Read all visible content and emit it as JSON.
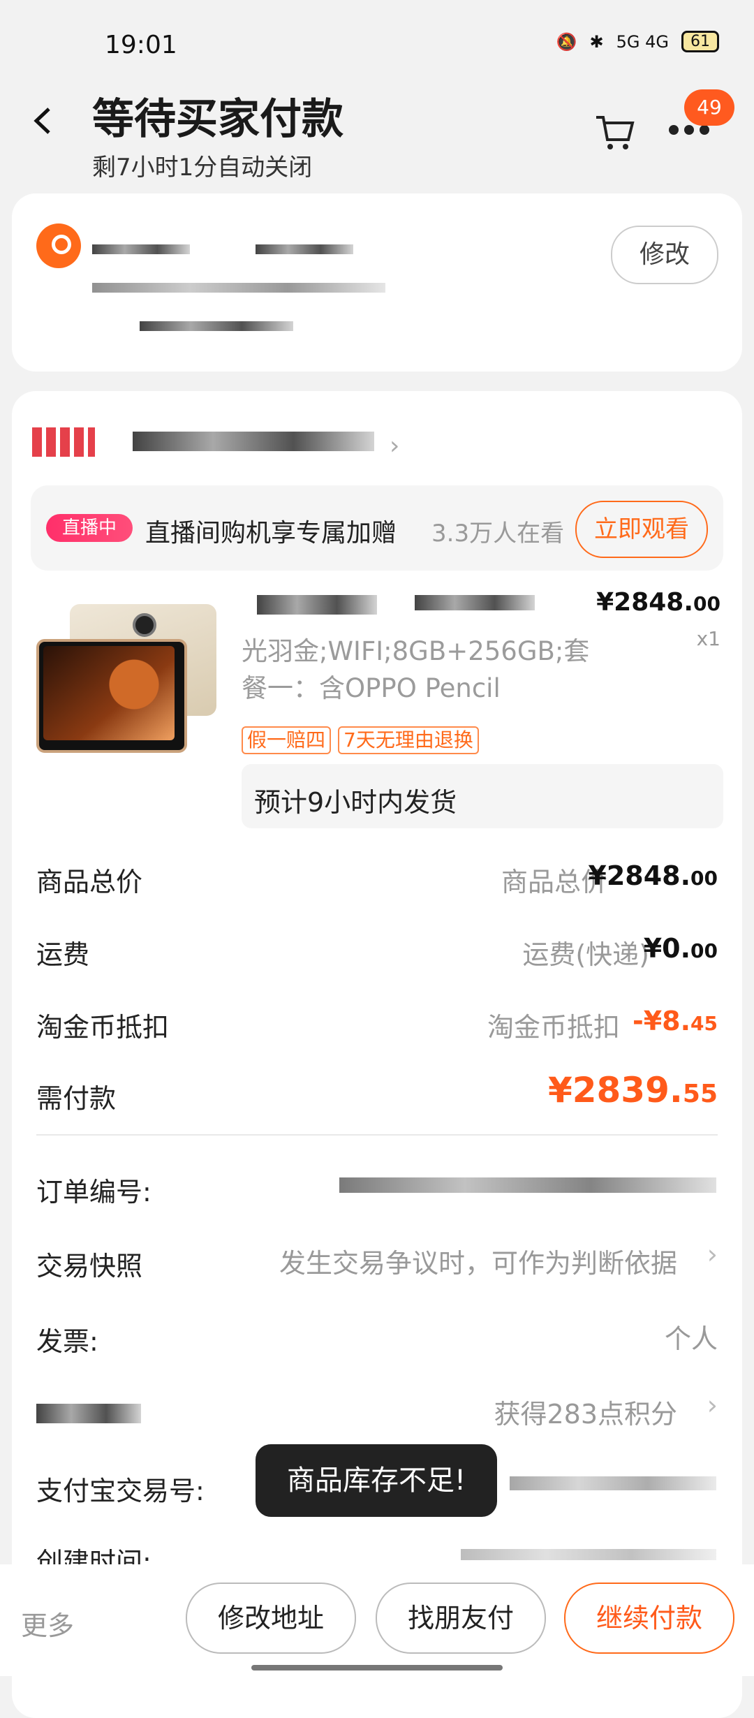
{
  "status_bar": {
    "time": "19:01",
    "network": "5G 4G",
    "battery": "61"
  },
  "header": {
    "title": "等待买家付款",
    "subtitle": "剩7小时1分自动关闭",
    "cart_badge": "49"
  },
  "address": {
    "edit_label": "修改"
  },
  "live": {
    "tag": "直播中",
    "text": "直播间购机享专属加赠",
    "viewers": "3.3万人在看",
    "watch_button": "立即观看"
  },
  "product": {
    "price_main": "¥2848.",
    "price_decimal": "00",
    "quantity": "x1",
    "spec": "光羽金;WIFI;8GB+256GB;套餐一：含OPPO Pencil",
    "tags": [
      "假一赔四",
      "7天无理由退换"
    ],
    "shipping_note": "预计9小时内发货"
  },
  "summary": {
    "total_label": "商品总价",
    "total_sub": "商品总价",
    "total_main": "¥2848.",
    "total_decimal": "00",
    "freight_label": "运费",
    "freight_sub": "运费(快递)",
    "freight_main": "¥0.",
    "freight_decimal": "00",
    "coin_label": "淘金币抵扣",
    "coin_sub": "淘金币抵扣",
    "coin_main": "-¥8.",
    "coin_decimal": "45",
    "pay_label": "需付款",
    "pay_main": "¥2839.",
    "pay_decimal": "55"
  },
  "details": {
    "order_no_label": "订单编号:",
    "snapshot_label": "交易快照",
    "snapshot_value": "发生交易争议时，可作为判断依据",
    "invoice_label": "发票:",
    "invoice_value": "个人",
    "points_value": "获得283点积分",
    "alipay_label": "支付宝交易号:",
    "created_label": "创建时间:"
  },
  "toast": "商品库存不足!",
  "bottom_bar": {
    "more": "更多",
    "change_address": "修改地址",
    "friend_pay": "找朋友付",
    "continue_pay": "继续付款"
  },
  "colors": {
    "accent": "#ff5a1a",
    "live": "#ff2f6a",
    "background": "#f2f2f2"
  }
}
